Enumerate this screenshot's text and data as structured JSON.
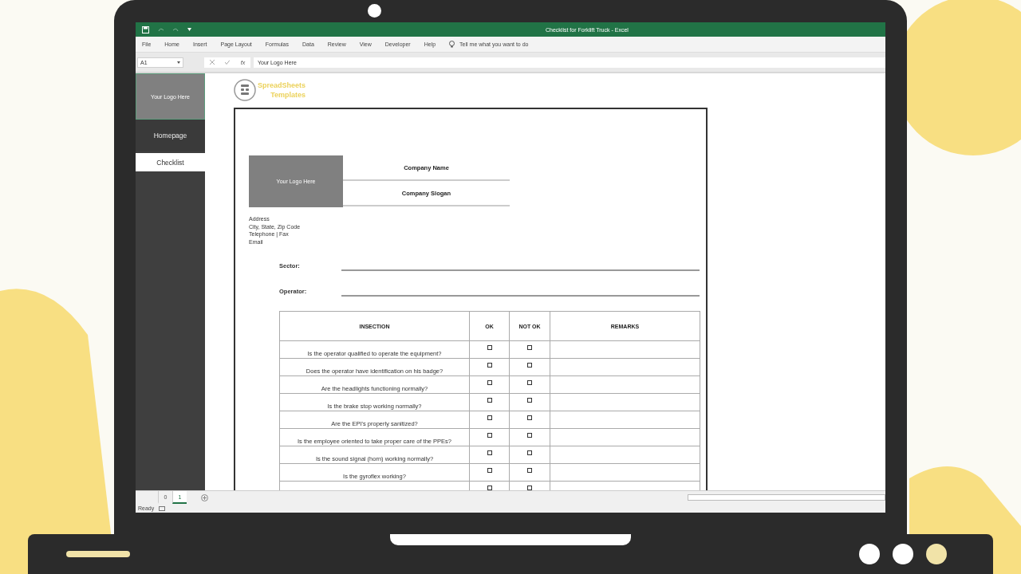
{
  "window": {
    "title": "Checklist for Forklift Truck  -  Excel"
  },
  "menu": [
    "File",
    "Home",
    "Insert",
    "Page Layout",
    "Formulas",
    "Data",
    "Review",
    "View",
    "Developer",
    "Help"
  ],
  "tell_me": "Tell me what you want to do",
  "formula_bar": {
    "name_box": "A1",
    "fx": "fx",
    "value": "Your Logo Here"
  },
  "sidebar": {
    "logo": "Your Logo Here",
    "items": [
      {
        "label": "Homepage",
        "selected": false
      },
      {
        "label": "Checklist",
        "selected": true
      }
    ]
  },
  "brand": {
    "line1": "SpreadSheets",
    "line2": "Templates"
  },
  "document": {
    "logo": "Your Logo Here",
    "company_name": "Company Name",
    "company_slogan": "Company Slogan",
    "address_lines": [
      "Address",
      "City, State, Zip Code",
      "Telephone | Fax",
      "Email"
    ],
    "fields": [
      {
        "label": "Sector:"
      },
      {
        "label": "Operator:"
      }
    ],
    "table": {
      "columns": [
        "INSECTION",
        "OK",
        "NOT OK",
        "REMARKS"
      ],
      "rows": [
        {
          "question": "Is the operator qualified to operate the equipment?",
          "ok_checked": false,
          "not_ok_checked": false
        },
        {
          "question": "Does the operator have identification on his badge?",
          "ok_checked": false,
          "not_ok_checked": false
        },
        {
          "question": "Are the headlights functioning normally?",
          "ok_checked": false,
          "not_ok_checked": false
        },
        {
          "question": "Is the brake stop working normally?",
          "ok_checked": false,
          "not_ok_checked": false
        },
        {
          "question": "Are the EPI's properly sanitized?",
          "ok_checked": false,
          "not_ok_checked": false
        },
        {
          "question": "Is the employee oriented to take proper care of the PPEs?",
          "ok_checked": false,
          "not_ok_checked": false
        },
        {
          "question": "Is the sound signal (horn) working normally?",
          "ok_checked": false,
          "not_ok_checked": false
        },
        {
          "question": "Is the gyroflex working?",
          "ok_checked": false,
          "not_ok_checked": false
        },
        {
          "ok_checked": false,
          "not_ok_checked": false
        }
      ]
    }
  },
  "sheet_tabs": [
    {
      "label": "0",
      "selected": false
    },
    {
      "label": "1",
      "selected": true
    }
  ],
  "status_bar": {
    "text": "Ready"
  }
}
